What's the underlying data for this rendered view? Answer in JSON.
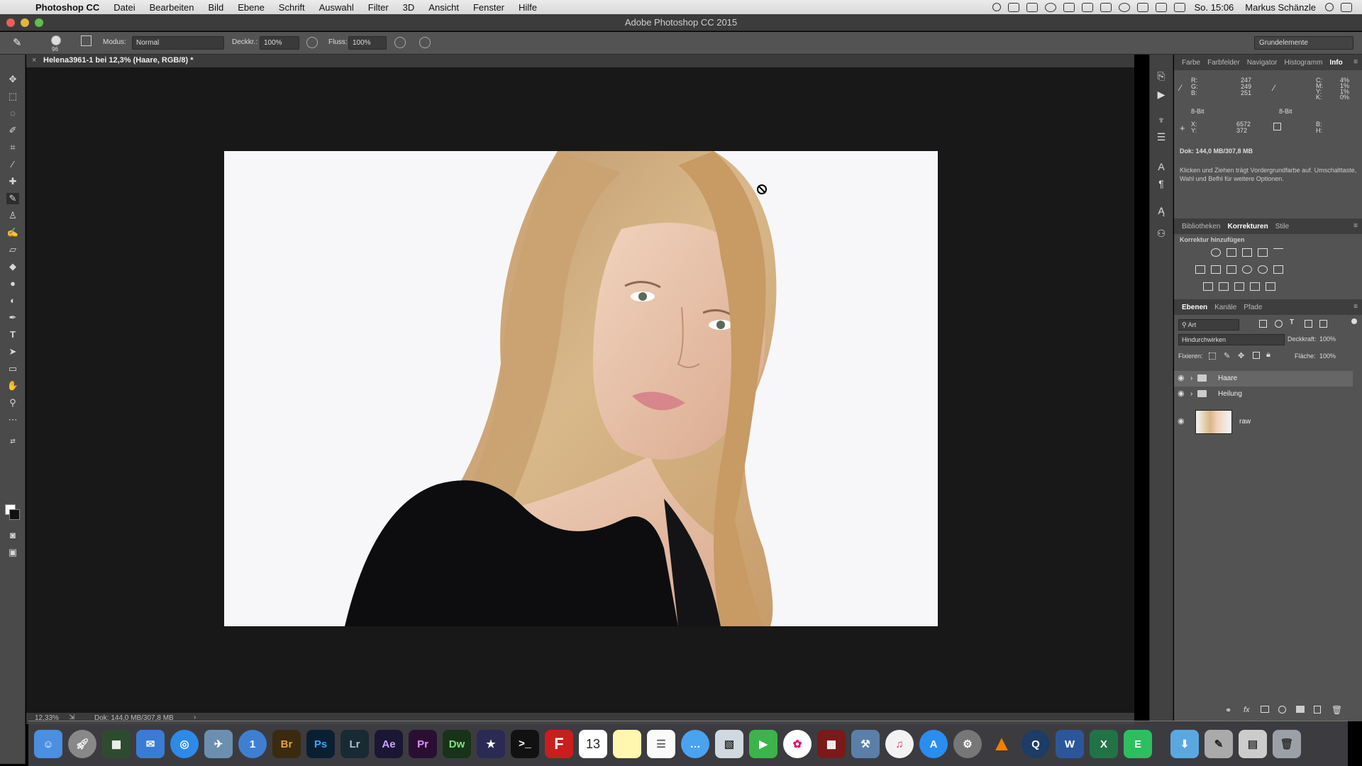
{
  "menubar": {
    "apple_icon": "apple-icon",
    "app_name": "Photoshop CC",
    "items": [
      "Datei",
      "Bearbeiten",
      "Bild",
      "Ebene",
      "Schrift",
      "Auswahl",
      "Filter",
      "3D",
      "Ansicht",
      "Fenster",
      "Hilfe"
    ],
    "clock": "So. 15:06",
    "user": "Markus Schänzle"
  },
  "window": {
    "title": "Adobe Photoshop CC 2015"
  },
  "options_bar": {
    "brush_size": "96",
    "mode_label": "Modus:",
    "mode_value": "Normal",
    "opacity_label": "Deckkr.:",
    "opacity_value": "100%",
    "flow_label": "Fluss:",
    "flow_value": "100%",
    "workspace": "Grundelemente"
  },
  "document": {
    "tab_title": "Helena3961-1 bei 12,3% (Haare, RGB/8) *",
    "zoom": "12,33%",
    "doc_status": "Dok: 144,0 MB/307,8 MB"
  },
  "info_panel": {
    "tabs": [
      "Farbe",
      "Farbfelder",
      "Navigator",
      "Histogramm",
      "Info"
    ],
    "active_tab": "Info",
    "rgb_labels": "R:\nG:\nB:",
    "rgb_values": "247\n249\n251",
    "bit_left": "8-Bit",
    "cmyk_labels": "C:\nM:\nY:\nK:",
    "cmyk_values": "4%\n1%\n1%\n0%",
    "bit_right": "8-Bit",
    "xy_labels": "X:\nY:",
    "xy_values": "6572\n372",
    "bh_labels": "B:\nH:",
    "doc_info": "Dok: 144,0 MB/307,8 MB",
    "hint": "Klicken und Ziehen trägt Vordergrundfarbe auf. Umschalttaste, Wahl und Befhl für weitere Optionen."
  },
  "adjustments_panel": {
    "tabs": [
      "Bibliotheken",
      "Korrekturen",
      "Stile"
    ],
    "active_tab": "Korrekturen",
    "heading": "Korrektur hinzufügen"
  },
  "layers_panel": {
    "tabs": [
      "Ebenen",
      "Kanäle",
      "Pfade"
    ],
    "active_tab": "Ebenen",
    "filter_label": "Art",
    "blend_mode": "Hindurchwirken",
    "opacity_label": "Deckkraft:",
    "opacity_value": "100%",
    "lock_label": "Fixieren:",
    "fill_label": "Fläche:",
    "fill_value": "100%",
    "layers": [
      {
        "name": "Haare",
        "type": "group"
      },
      {
        "name": "Heilung",
        "type": "group"
      },
      {
        "name": "raw",
        "type": "image"
      }
    ]
  },
  "dock": {
    "apps": [
      "Finder",
      "Launchpad",
      "Mission Control",
      "Mail",
      "Safari",
      "Preview",
      "1Password",
      "Br",
      "Ps",
      "Lr",
      "Ae",
      "Pr",
      "Dw",
      "iMovie",
      "Terminal",
      "FileZilla",
      "Kalender",
      "Notizen",
      "Erinnerungen",
      "Nachrichten",
      "Vorschau",
      "FaceTime",
      "Fotos",
      "Photo Booth",
      "Xcode",
      "iTunes",
      "App Store",
      "Systemeinstellungen",
      "VLC",
      "QuickTime",
      "Word",
      "Excel",
      "Evernote",
      "Downloads",
      "Brushes",
      "Dokumente",
      "Papierkorb"
    ],
    "calendar_day": "13"
  }
}
